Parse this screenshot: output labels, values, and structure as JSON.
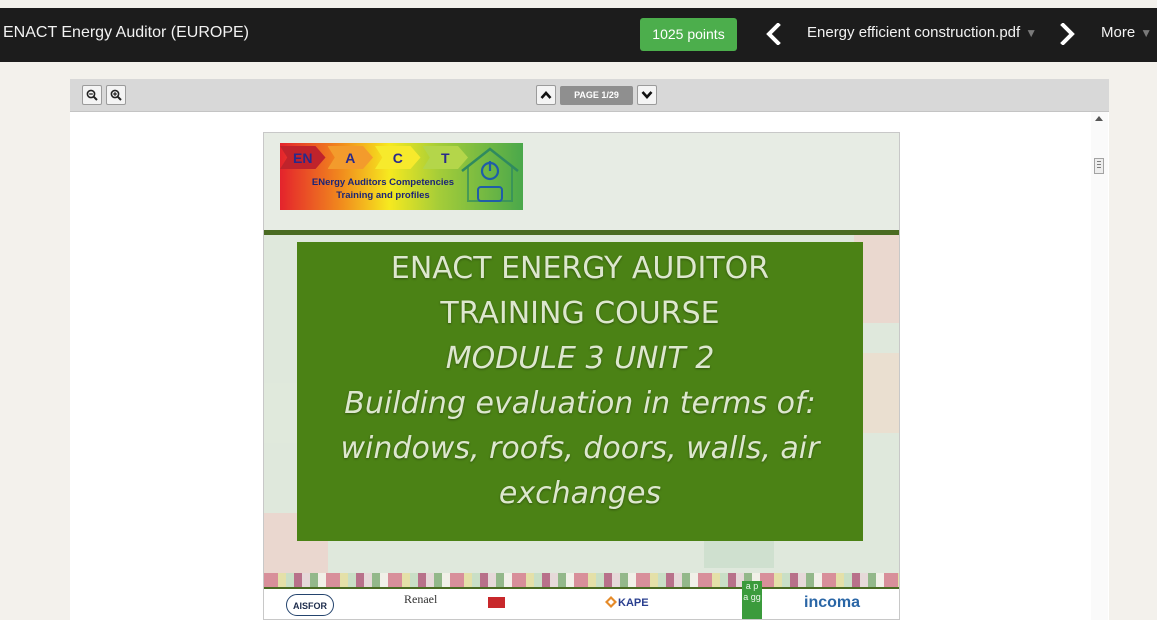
{
  "topbar": {
    "app_title": "ENACT Energy Auditor (EUROPE)",
    "points": "1025 points",
    "file_name": "Energy efficient construction.pdf",
    "more_label": "More",
    "icons": [
      "chevron-left-icon",
      "chevron-right-icon",
      "caret-down-icon"
    ],
    "points_color": "#4cae4c"
  },
  "viewer": {
    "page_indicator": "PAGE 1/29",
    "icons": [
      "zoom-out-icon",
      "zoom-in-icon",
      "chevron-up-icon",
      "chevron-down-icon"
    ]
  },
  "slide": {
    "logo": {
      "letters": [
        "EN",
        "A",
        "C",
        "T"
      ],
      "line1": "ENergy Auditors Competencies",
      "line2": "Training  and profiles"
    },
    "title_lines": [
      "ENACT ENERGY AUDITOR",
      "TRAINING COURSE",
      "MODULE 3 UNIT 2",
      "Building evaluation in terms of:",
      "windows, roofs, doors, walls, air",
      "exchanges"
    ],
    "title_box_color": "#4b8215",
    "partners": {
      "aisfor": "AISFOR",
      "renael": "Renael",
      "kape": "KAPE",
      "apgg": "a p a gg",
      "incoma": "incoma"
    }
  }
}
